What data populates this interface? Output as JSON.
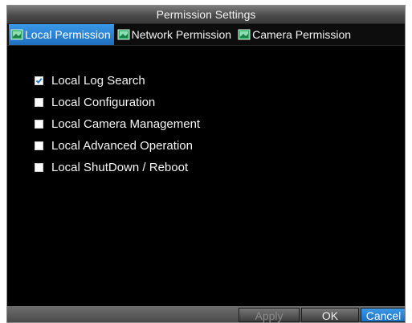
{
  "dialog": {
    "title": "Permission Settings"
  },
  "tabs": [
    {
      "label": "Local Permission",
      "active": true
    },
    {
      "label": "Network Permission",
      "active": false
    },
    {
      "label": "Camera Permission",
      "active": false
    }
  ],
  "permissions": [
    {
      "label": "Local Log Search",
      "checked": true
    },
    {
      "label": "Local Configuration",
      "checked": false
    },
    {
      "label": "Local Camera Management",
      "checked": false
    },
    {
      "label": "Local Advanced Operation",
      "checked": false
    },
    {
      "label": "Local ShutDown / Reboot",
      "checked": false
    }
  ],
  "buttons": {
    "apply": "Apply",
    "ok": "OK",
    "cancel": "Cancel"
  },
  "colors": {
    "accent": "#2a86d8",
    "background": "#000000",
    "check": "#2f78d0"
  }
}
